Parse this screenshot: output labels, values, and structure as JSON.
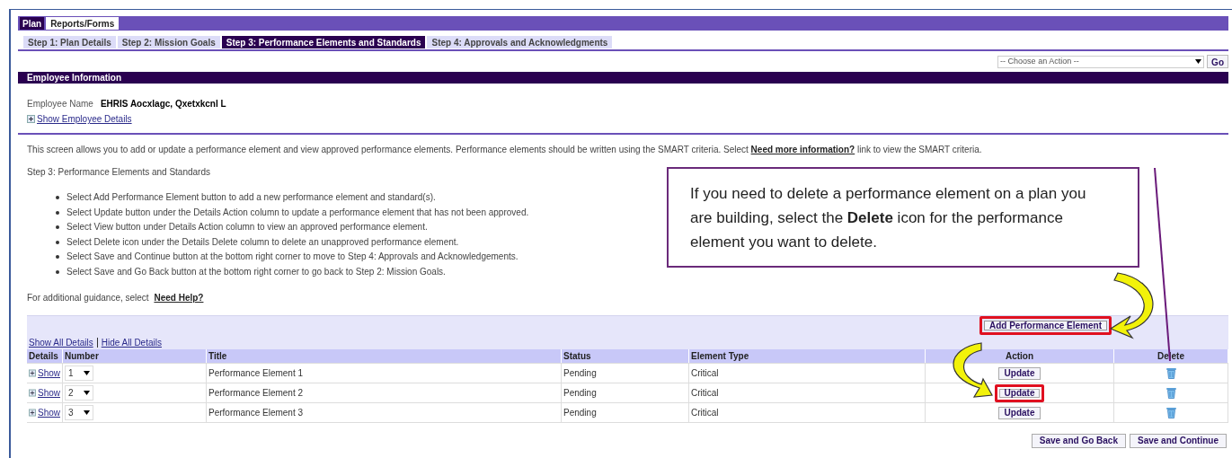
{
  "top_tabs": [
    {
      "label": "Plan",
      "selected": true
    },
    {
      "label": "Reports/Forms",
      "selected": false
    }
  ],
  "step_tabs": [
    {
      "label": "Step 1: Plan Details",
      "selected": false
    },
    {
      "label": "Step 2: Mission Goals",
      "selected": false
    },
    {
      "label": "Step 3: Performance Elements and Standards",
      "selected": true
    },
    {
      "label": "Step 4: Approvals and Acknowledgments",
      "selected": false
    }
  ],
  "action_select": {
    "value": "-- Choose an Action --"
  },
  "go_button": "Go",
  "section_title": "Employee Information",
  "employee": {
    "label": "Employee Name",
    "value": "EHRIS Aocxlagc, Qxetxkcnl L",
    "details_link": "Show Employee Details"
  },
  "intro": {
    "before": "This screen allows you to add or update a performance element and view approved performance elements. Performance elements should be written using the SMART criteria. Select",
    "link": "Need more information?",
    "after": "link to view the SMART criteria."
  },
  "step_heading": "Step 3: Performance Elements and Standards",
  "instructions": [
    "Select Add Performance Element button to add a new performance element and standard(s).",
    "Select Update button under the Details Action column to update a performance element that has not been approved.",
    "Select View button under Details Action column to view an approved performance element.",
    "Select Delete icon under the Details Delete column to delete an unapproved performance element.",
    "Select Save and Continue button at the bottom right corner to move to Step 4: Approvals and Acknowledgements.",
    "Select Save and Go Back button at the bottom right corner to go back to Step 2: Mission Goals."
  ],
  "help": {
    "text": "For additional guidance, select",
    "link": "Need Help?"
  },
  "add_button": {
    "label": "Add Performance Element",
    "highlighted": true
  },
  "detail_links": [
    "Show All Details",
    "Hide All Details"
  ],
  "table": {
    "columns": [
      "Details",
      "Number",
      "Title",
      "Status",
      "Element Type",
      "Action",
      "Delete"
    ],
    "rows": [
      {
        "details_link": "Show",
        "number": "1",
        "title": "Performance Element 1",
        "status": "Pending",
        "element_type": "Critical",
        "action": "Update",
        "highlighted": false
      },
      {
        "details_link": "Show",
        "number": "2",
        "title": "Performance Element 2",
        "status": "Pending",
        "element_type": "Critical",
        "action": "Update",
        "highlighted": true
      },
      {
        "details_link": "Show",
        "number": "3",
        "title": "Performance Element 3",
        "status": "Pending",
        "element_type": "Critical",
        "action": "Update",
        "highlighted": false
      }
    ]
  },
  "footer_buttons": [
    "Save and Go Back",
    "Save and Continue"
  ],
  "callout": {
    "text": "If you need to delete a performance element on a plan you are building, select the **Delete** icon for the performance element you want to delete."
  }
}
